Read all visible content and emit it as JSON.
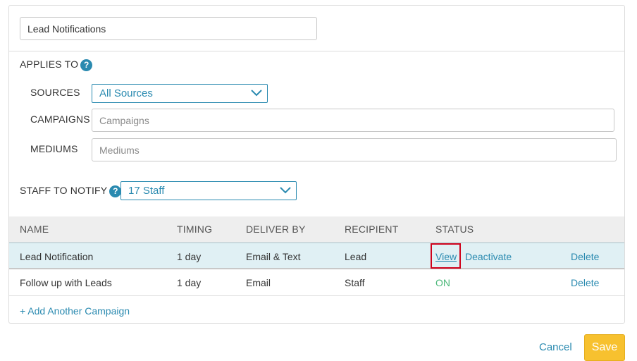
{
  "form": {
    "name_value": "Lead Notifications"
  },
  "applies_to": {
    "label": "APPLIES TO",
    "help_glyph": "?",
    "sources_label": "SOURCES",
    "sources_value": "All Sources",
    "campaigns_label": "CAMPAIGNS",
    "campaigns_placeholder": "Campaigns",
    "mediums_label": "MEDIUMS",
    "mediums_placeholder": "Mediums"
  },
  "staff": {
    "label": "STAFF TO NOTIFY",
    "help_glyph": "?",
    "value": "17 Staff"
  },
  "table": {
    "headers": [
      "NAME",
      "TIMING",
      "DELIVER BY",
      "RECIPIENT",
      "STATUS"
    ],
    "rows": [
      {
        "name": "Lead Notification",
        "timing": "1 day",
        "deliver_by": "Email & Text",
        "recipient": "Lead",
        "view_label": "View",
        "deactivate_label": "Deactivate",
        "delete_label": "Delete"
      },
      {
        "name": "Follow up with Leads",
        "timing": "1 day",
        "deliver_by": "Email",
        "recipient": "Staff",
        "status": "ON",
        "delete_label": "Delete"
      }
    ]
  },
  "add_campaign_label": "+ Add Another Campaign",
  "footer": {
    "cancel_label": "Cancel",
    "save_label": "Save"
  },
  "colors": {
    "accent": "#2a8ab0",
    "save": "#f7c12f",
    "status_on": "#4cb87a",
    "highlight": "#d0021b"
  }
}
